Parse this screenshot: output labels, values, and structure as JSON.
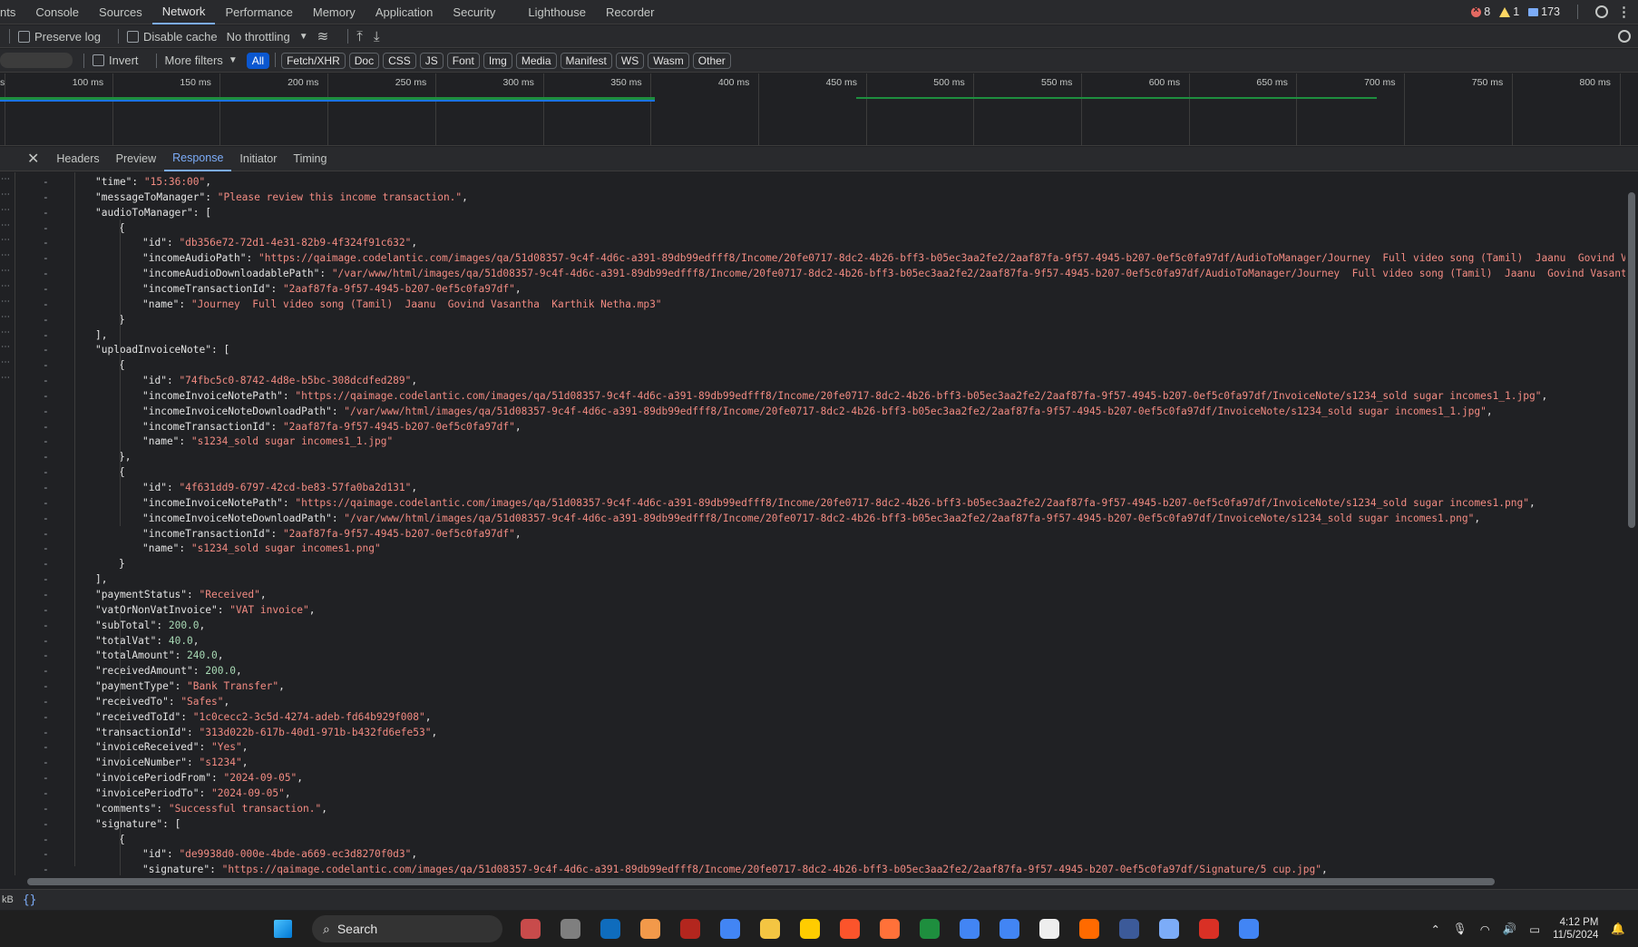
{
  "tabs": [
    "nts",
    "Console",
    "Sources",
    "Network",
    "Performance",
    "Memory",
    "Application",
    "Security",
    "Lighthouse",
    "Recorder"
  ],
  "active_tab": "Network",
  "counts": {
    "errors": "8",
    "warnings": "1",
    "messages": "173"
  },
  "toolbar": {
    "preserve_log": "Preserve log",
    "disable_cache": "Disable cache",
    "throttling": "No throttling"
  },
  "filters": {
    "invert": "Invert",
    "more_filters": "More filters",
    "types": [
      "All",
      "Fetch/XHR",
      "Doc",
      "CSS",
      "JS",
      "Font",
      "Img",
      "Media",
      "Manifest",
      "WS",
      "Wasm",
      "Other"
    ],
    "active": "All"
  },
  "overview": {
    "ticks": [
      "s",
      "100 ms",
      "150 ms",
      "200 ms",
      "250 ms",
      "300 ms",
      "350 ms",
      "400 ms",
      "450 ms",
      "500 ms",
      "550 ms",
      "600 ms",
      "650 ms",
      "700 ms",
      "750 ms",
      "800 ms"
    ]
  },
  "detail_tabs": [
    "Headers",
    "Preview",
    "Response",
    "Initiator",
    "Timing"
  ],
  "active_detail": "Response",
  "code_lines": [
    {
      "i": 1,
      "k": "\"time\"",
      "v": "\"15:36:00\"",
      "t": "str",
      "end": ","
    },
    {
      "i": 1,
      "k": "\"messageToManager\"",
      "v": "\"Please review this income transaction.\"",
      "t": "str",
      "end": ","
    },
    {
      "i": 1,
      "k": "\"audioToManager\"",
      "v": "[",
      "t": "pun",
      "end": ""
    },
    {
      "i": 2,
      "k": "",
      "v": "{",
      "t": "pun",
      "end": ""
    },
    {
      "i": 3,
      "k": "\"id\"",
      "v": "\"db356e72-72d1-4e31-82b9-4f324f91c632\"",
      "t": "str",
      "end": ","
    },
    {
      "i": 3,
      "k": "\"incomeAudioPath\"",
      "v": "\"https://qaimage.codelantic.com/images/qa/51d08357-9c4f-4d6c-a391-89db99edfff8/Income/20fe0717-8dc2-4b26-bff3-b05ec3aa2fe2/2aaf87fa-9f57-4945-b207-0ef5c0fa97df/AudioToManager/Journey  Full video song (Tamil)  Jaanu  Govind Vasant",
      "t": "str",
      "end": ""
    },
    {
      "i": 3,
      "k": "\"incomeAudioDownloadablePath\"",
      "v": "\"/var/www/html/images/qa/51d08357-9c4f-4d6c-a391-89db99edfff8/Income/20fe0717-8dc2-4b26-bff3-b05ec3aa2fe2/2aaf87fa-9f57-4945-b207-0ef5c0fa97df/AudioToManager/Journey  Full video song (Tamil)  Jaanu  Govind Vasantha  K",
      "t": "str",
      "end": ""
    },
    {
      "i": 3,
      "k": "\"incomeTransactionId\"",
      "v": "\"2aaf87fa-9f57-4945-b207-0ef5c0fa97df\"",
      "t": "str",
      "end": ","
    },
    {
      "i": 3,
      "k": "\"name\"",
      "v": "\"Journey  Full video song (Tamil)  Jaanu  Govind Vasantha  Karthik Netha.mp3\"",
      "t": "str",
      "end": ""
    },
    {
      "i": 2,
      "k": "",
      "v": "}",
      "t": "pun",
      "end": ""
    },
    {
      "i": 1,
      "k": "",
      "v": "],",
      "t": "pun",
      "end": ""
    },
    {
      "i": 1,
      "k": "\"uploadInvoiceNote\"",
      "v": "[",
      "t": "pun",
      "end": ""
    },
    {
      "i": 2,
      "k": "",
      "v": "{",
      "t": "pun",
      "end": ""
    },
    {
      "i": 3,
      "k": "\"id\"",
      "v": "\"74fbc5c0-8742-4d8e-b5bc-308dcdfed289\"",
      "t": "str",
      "end": ","
    },
    {
      "i": 3,
      "k": "\"incomeInvoiceNotePath\"",
      "v": "\"https://qaimage.codelantic.com/images/qa/51d08357-9c4f-4d6c-a391-89db99edfff8/Income/20fe0717-8dc2-4b26-bff3-b05ec3aa2fe2/2aaf87fa-9f57-4945-b207-0ef5c0fa97df/InvoiceNote/s1234_sold sugar incomes1_1.jpg\"",
      "t": "str",
      "end": ","
    },
    {
      "i": 3,
      "k": "\"incomeInvoiceNoteDownloadPath\"",
      "v": "\"/var/www/html/images/qa/51d08357-9c4f-4d6c-a391-89db99edfff8/Income/20fe0717-8dc2-4b26-bff3-b05ec3aa2fe2/2aaf87fa-9f57-4945-b207-0ef5c0fa97df/InvoiceNote/s1234_sold sugar incomes1_1.jpg\"",
      "t": "str",
      "end": ","
    },
    {
      "i": 3,
      "k": "\"incomeTransactionId\"",
      "v": "\"2aaf87fa-9f57-4945-b207-0ef5c0fa97df\"",
      "t": "str",
      "end": ","
    },
    {
      "i": 3,
      "k": "\"name\"",
      "v": "\"s1234_sold sugar incomes1_1.jpg\"",
      "t": "str",
      "end": ""
    },
    {
      "i": 2,
      "k": "",
      "v": "},",
      "t": "pun",
      "end": ""
    },
    {
      "i": 2,
      "k": "",
      "v": "{",
      "t": "pun",
      "end": ""
    },
    {
      "i": 3,
      "k": "\"id\"",
      "v": "\"4f631dd9-6797-42cd-be83-57fa0ba2d131\"",
      "t": "str",
      "end": ","
    },
    {
      "i": 3,
      "k": "\"incomeInvoiceNotePath\"",
      "v": "\"https://qaimage.codelantic.com/images/qa/51d08357-9c4f-4d6c-a391-89db99edfff8/Income/20fe0717-8dc2-4b26-bff3-b05ec3aa2fe2/2aaf87fa-9f57-4945-b207-0ef5c0fa97df/InvoiceNote/s1234_sold sugar incomes1.png\"",
      "t": "str",
      "end": ","
    },
    {
      "i": 3,
      "k": "\"incomeInvoiceNoteDownloadPath\"",
      "v": "\"/var/www/html/images/qa/51d08357-9c4f-4d6c-a391-89db99edfff8/Income/20fe0717-8dc2-4b26-bff3-b05ec3aa2fe2/2aaf87fa-9f57-4945-b207-0ef5c0fa97df/InvoiceNote/s1234_sold sugar incomes1.png\"",
      "t": "str",
      "end": ","
    },
    {
      "i": 3,
      "k": "\"incomeTransactionId\"",
      "v": "\"2aaf87fa-9f57-4945-b207-0ef5c0fa97df\"",
      "t": "str",
      "end": ","
    },
    {
      "i": 3,
      "k": "\"name\"",
      "v": "\"s1234_sold sugar incomes1.png\"",
      "t": "str",
      "end": ""
    },
    {
      "i": 2,
      "k": "",
      "v": "}",
      "t": "pun",
      "end": ""
    },
    {
      "i": 1,
      "k": "",
      "v": "],",
      "t": "pun",
      "end": ""
    },
    {
      "i": 1,
      "k": "\"paymentStatus\"",
      "v": "\"Received\"",
      "t": "str",
      "end": ","
    },
    {
      "i": 1,
      "k": "\"vatOrNonVatInvoice\"",
      "v": "\"VAT invoice\"",
      "t": "str",
      "end": ","
    },
    {
      "i": 1,
      "k": "\"subTotal\"",
      "v": "200.0",
      "t": "num",
      "end": ","
    },
    {
      "i": 1,
      "k": "\"totalVat\"",
      "v": "40.0",
      "t": "num",
      "end": ","
    },
    {
      "i": 1,
      "k": "\"totalAmount\"",
      "v": "240.0",
      "t": "num",
      "end": ","
    },
    {
      "i": 1,
      "k": "\"receivedAmount\"",
      "v": "200.0",
      "t": "num",
      "end": ","
    },
    {
      "i": 1,
      "k": "\"paymentType\"",
      "v": "\"Bank Transfer\"",
      "t": "str",
      "end": ","
    },
    {
      "i": 1,
      "k": "\"receivedTo\"",
      "v": "\"Safes\"",
      "t": "str",
      "end": ","
    },
    {
      "i": 1,
      "k": "\"receivedToId\"",
      "v": "\"1c0cecc2-3c5d-4274-adeb-fd64b929f008\"",
      "t": "str",
      "end": ","
    },
    {
      "i": 1,
      "k": "\"transactionId\"",
      "v": "\"313d022b-617b-40d1-971b-b432fd6efe53\"",
      "t": "str",
      "end": ","
    },
    {
      "i": 1,
      "k": "\"invoiceReceived\"",
      "v": "\"Yes\"",
      "t": "str",
      "end": ","
    },
    {
      "i": 1,
      "k": "\"invoiceNumber\"",
      "v": "\"s1234\"",
      "t": "str",
      "end": ","
    },
    {
      "i": 1,
      "k": "\"invoicePeriodFrom\"",
      "v": "\"2024-09-05\"",
      "t": "str",
      "end": ","
    },
    {
      "i": 1,
      "k": "\"invoicePeriodTo\"",
      "v": "\"2024-09-05\"",
      "t": "str",
      "end": ","
    },
    {
      "i": 1,
      "k": "\"comments\"",
      "v": "\"Successful transaction.\"",
      "t": "str",
      "end": ","
    },
    {
      "i": 1,
      "k": "\"signature\"",
      "v": "[",
      "t": "pun",
      "end": ""
    },
    {
      "i": 2,
      "k": "",
      "v": "{",
      "t": "pun",
      "end": ""
    },
    {
      "i": 3,
      "k": "\"id\"",
      "v": "\"de9938d0-000e-4bde-a669-ec3d8270f0d3\"",
      "t": "str",
      "end": ","
    },
    {
      "i": 3,
      "k": "\"signature\"",
      "v": "\"https://qaimage.codelantic.com/images/qa/51d08357-9c4f-4d6c-a391-89db99edfff8/Income/20fe0717-8dc2-4b26-bff3-b05ec3aa2fe2/2aaf87fa-9f57-4945-b207-0ef5c0fa97df/Signature/5 cup.jpg\"",
      "t": "str",
      "end": ","
    }
  ],
  "status": {
    "size_unit": "kB",
    "format": "{}"
  },
  "taskbar": {
    "search": "Search",
    "time": "4:12 PM",
    "date": "11/5/2024"
  },
  "colors": {
    "accent": "#7cacf8",
    "string": "#f28b82",
    "number": "#a8dab5",
    "bar_green": "#1e8e3e",
    "bar_blue": "#1a73e8"
  }
}
